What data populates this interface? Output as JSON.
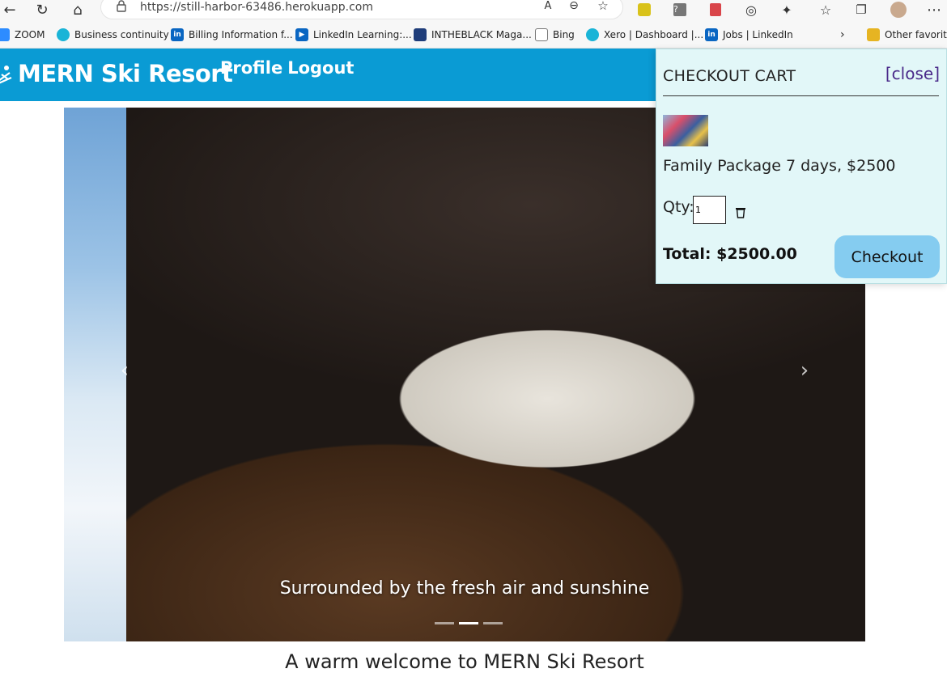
{
  "browser": {
    "url": "https://still-harbor-63486.herokuapp.com",
    "bookmarks": [
      {
        "label": "ZOOM",
        "icon": "zoom-icon",
        "color": "#2d8cff"
      },
      {
        "label": "Business continuity",
        "icon": "xero-icon",
        "color": "#1ab4d7"
      },
      {
        "label": "Billing Information f...",
        "icon": "linkedin-icon",
        "color": "#0a66c2"
      },
      {
        "label": "LinkedIn Learning:...",
        "icon": "linkedin-learning-icon",
        "color": "#0a66c2"
      },
      {
        "label": "INTHEBLACK Maga...",
        "icon": "cpa-icon",
        "color": "#1f3d7a"
      },
      {
        "label": "Bing",
        "icon": "page-icon",
        "color": "#888888"
      },
      {
        "label": "Xero | Dashboard |...",
        "icon": "xero-icon",
        "color": "#1ab4d7"
      },
      {
        "label": "Jobs | LinkedIn",
        "icon": "linkedin-icon",
        "color": "#0a66c2"
      },
      {
        "label": "Other favorite",
        "icon": "folder-icon",
        "color": "#e6b422"
      }
    ]
  },
  "app": {
    "brand": "MERN Ski Resort",
    "nav": {
      "profile": "Profile",
      "logout": "Logout"
    },
    "header_color": "#0a9bd4"
  },
  "carousel": {
    "caption": "Surrounded by the fresh air and sunshine",
    "indicator_count": 3,
    "active_index": 1
  },
  "welcome": "A warm welcome to MERN Ski Resort",
  "cart": {
    "title": "CHECKOUT CART",
    "close_label": "[close]",
    "item_name": "Family Package 7 days, $2500",
    "qty_label": "Qty:",
    "qty_value": "1",
    "total": "Total: $2500.00",
    "checkout_label": "Checkout",
    "background": "#e2f7f8",
    "button_color": "#85ccf0"
  }
}
